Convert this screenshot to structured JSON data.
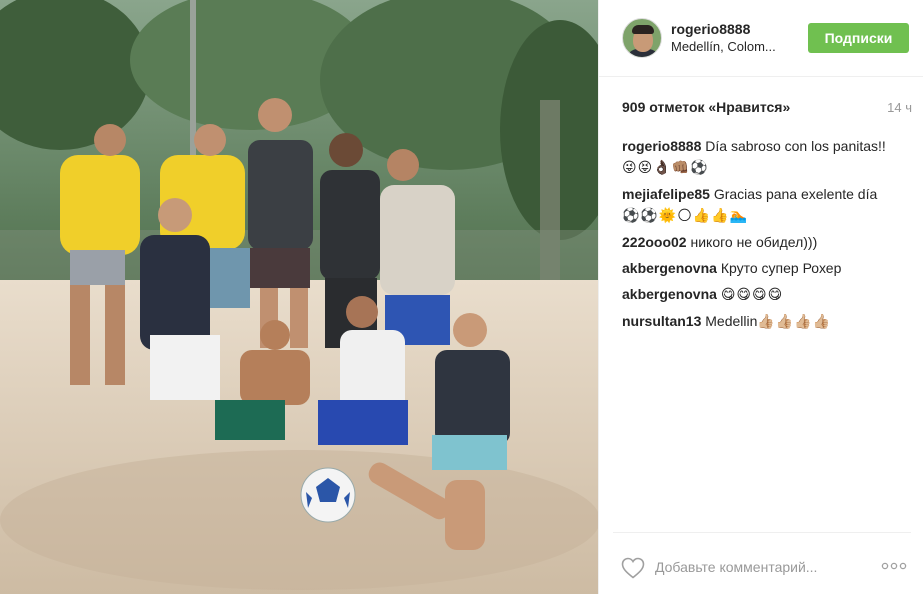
{
  "post": {
    "username": "rogerio8888",
    "location": "Medellín, Colom...",
    "follow_label": "Подписки",
    "likes": "909 отметок «Нравится»",
    "time": "14 ч"
  },
  "comments": [
    {
      "user": "rogerio8888",
      "text": "Día sabroso con los panitas!!",
      "emoji": "😜😝👌🏿👊🏽⚽"
    },
    {
      "user": "mejiafelipe85",
      "text": "Gracias pana exelente día",
      "emoji": "⚽⚽🌞🌕👍👍🏊"
    },
    {
      "user": "222ooo02",
      "text": "никого не обидел)))",
      "emoji": ""
    },
    {
      "user": "akbergenovna",
      "text": "Круто супер Рохер",
      "emoji": ""
    },
    {
      "user": "akbergenovna",
      "text": "",
      "emoji": "😋😋😋😋"
    },
    {
      "user": "nursultan13",
      "text": "Medellin",
      "emoji": "👍🏼👍🏼👍🏼👍🏼"
    }
  ],
  "footer": {
    "comment_placeholder": "Добавьте комментарий..."
  },
  "icons": {
    "heart": "heart-icon",
    "more": "more-options-icon",
    "avatar": "avatar"
  },
  "colors": {
    "follow_button": "#70c050",
    "muted_text": "#999999"
  }
}
